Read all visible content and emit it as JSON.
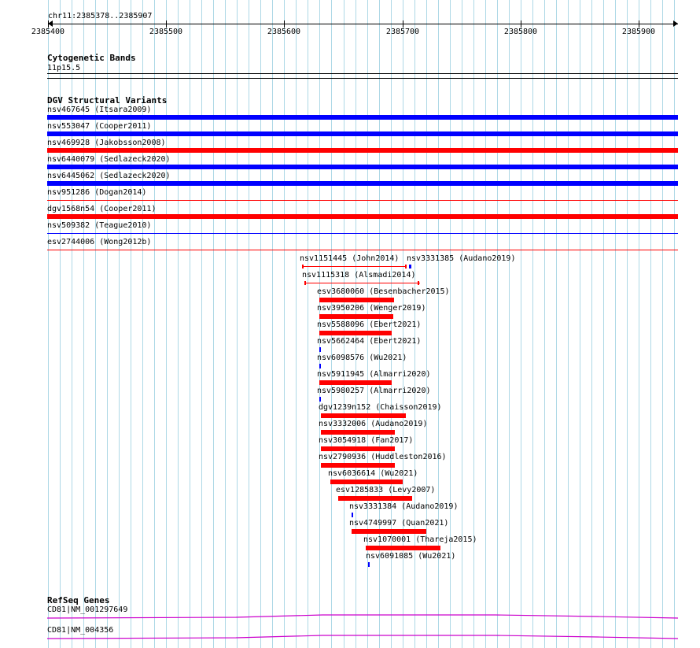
{
  "ruler": {
    "range_label": "chr11:2385378..2385907",
    "ticks": [
      "2385400",
      "2385500",
      "2385600",
      "2385700",
      "2385800",
      "2385900"
    ]
  },
  "cytoband": {
    "title": "Cytogenetic Bands",
    "band": "11p15.5"
  },
  "dgv": {
    "title": "DGV Structural Variants",
    "colors": {
      "gain": "#0000ff",
      "loss": "#ff0000"
    },
    "full_width": [
      {
        "label": "nsv467645 (Itsara2009)",
        "color": "#0000ff",
        "thick": true
      },
      {
        "label": "nsv553047 (Cooper2011)",
        "color": "#0000ff",
        "thick": true
      },
      {
        "label": "nsv469928 (Jakobsson2008)",
        "color": "#ff0000",
        "thick": true
      },
      {
        "label": "nsv6440079 (Sedlazeck2020)",
        "color": "#0000ff",
        "thick": true
      },
      {
        "label": "nsv6445062 (Sedlazeck2020)",
        "color": "#0000ff",
        "thick": true
      },
      {
        "label": "nsv951286 (Dogan2014)",
        "color": "#ff0000",
        "thick": false
      },
      {
        "label": "dgv1568n54 (Cooper2011)",
        "color": "#ff0000",
        "thick": true
      },
      {
        "label": "nsv509382 (Teague2010)",
        "color": "#0000ff",
        "thick": false
      },
      {
        "label": "esv2744006 (Wong2012b)",
        "color": "#ff0000",
        "thick": false
      }
    ],
    "features": [
      {
        "label": "nsv1151445 (John2014)",
        "start": 2385591,
        "end": 2385679,
        "color": "#ff0000",
        "style": "thin"
      },
      {
        "label": "nsv3331385 (Audano2019)",
        "start": 2385681,
        "end": 2385683,
        "color": "#0000ff",
        "style": "thin"
      },
      {
        "label": "nsv1115318 (Alsmadi2014)",
        "start": 2385593,
        "end": 2385690,
        "color": "#ff0000",
        "style": "thin"
      },
      {
        "label": "esv3680060 (Besenbacher2015)",
        "start": 2385606,
        "end": 2385669,
        "color": "#ff0000",
        "style": "thick"
      },
      {
        "label": "nsv3950206 (Wenger2019)",
        "start": 2385606,
        "end": 2385668,
        "color": "#ff0000",
        "style": "thick"
      },
      {
        "label": "nsv5588096 (Ebert2021)",
        "start": 2385606,
        "end": 2385667,
        "color": "#ff0000",
        "style": "thick"
      },
      {
        "label": "nsv5662464 (Ebert2021)",
        "start": 2385606,
        "end": 2385607,
        "color": "#0000ff",
        "style": "tiny"
      },
      {
        "label": "nsv6098576 (Wu2021)",
        "start": 2385606,
        "end": 2385607,
        "color": "#0000ff",
        "style": "tiny"
      },
      {
        "label": "nsv5911945 (Almarri2020)",
        "start": 2385606,
        "end": 2385667,
        "color": "#ff0000",
        "style": "thick"
      },
      {
        "label": "nsv5980257 (Almarri2020)",
        "start": 2385606,
        "end": 2385607,
        "color": "#0000ff",
        "style": "tiny"
      },
      {
        "label": "dgv1239n152 (Chaisson2019)",
        "start": 2385607,
        "end": 2385678,
        "color": "#ff0000",
        "style": "thick"
      },
      {
        "label": "nsv3332006 (Audano2019)",
        "start": 2385607,
        "end": 2385669,
        "color": "#ff0000",
        "style": "thick"
      },
      {
        "label": "nsv3054918 (Fan2017)",
        "start": 2385607,
        "end": 2385669,
        "color": "#ff0000",
        "style": "thick"
      },
      {
        "label": "nsv2790936 (Huddleston2016)",
        "start": 2385607,
        "end": 2385669,
        "color": "#ff0000",
        "style": "thick"
      },
      {
        "label": "nsv6036614 (Wu2021)",
        "start": 2385615,
        "end": 2385676,
        "color": "#ff0000",
        "style": "thick"
      },
      {
        "label": "esv1285833 (Levy2007)",
        "start": 2385622,
        "end": 2385684,
        "color": "#ff0000",
        "style": "thick"
      },
      {
        "label": "nsv3331384 (Audano2019)",
        "start": 2385633,
        "end": 2385634,
        "color": "#0000ff",
        "style": "tiny"
      },
      {
        "label": "nsv4749997 (Quan2021)",
        "start": 2385633,
        "end": 2385696,
        "color": "#ff0000",
        "style": "thick"
      },
      {
        "label": "nsv1070001 (Thareja2015)",
        "start": 2385645,
        "end": 2385708,
        "color": "#ff0000",
        "style": "thick"
      },
      {
        "label": "nsv6091085 (Wu2021)",
        "start": 2385647,
        "end": 2385648,
        "color": "#0000ff",
        "style": "tiny"
      }
    ]
  },
  "refseq": {
    "title": "RefSeq Genes",
    "color": "#cc00cc",
    "genes": [
      "CD81|NM_001297649",
      "CD81|NM_004356"
    ]
  }
}
